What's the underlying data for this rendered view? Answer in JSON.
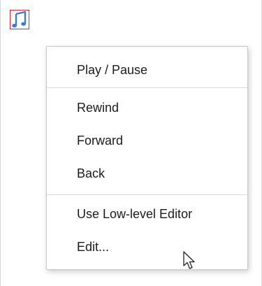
{
  "toolbar": {
    "music_icon": "music-note-icon",
    "accent_border": "#e0262a",
    "icon_color": "#3b7bd0"
  },
  "context_menu": {
    "groups": [
      {
        "items": [
          {
            "label": "Play / Pause"
          }
        ]
      },
      {
        "items": [
          {
            "label": "Rewind"
          },
          {
            "label": "Forward"
          },
          {
            "label": "Back"
          }
        ]
      },
      {
        "items": [
          {
            "label": "Use Low-level Editor"
          },
          {
            "label": "Edit..."
          }
        ]
      }
    ]
  }
}
